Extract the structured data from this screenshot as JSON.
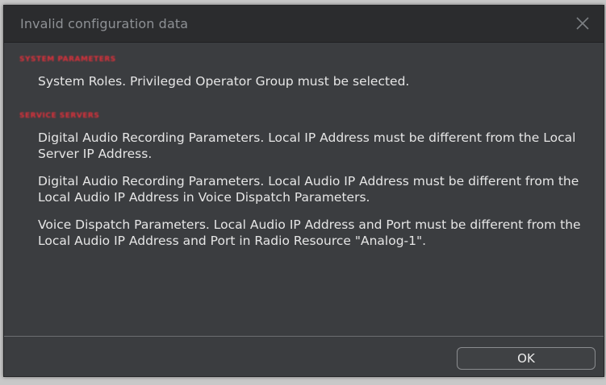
{
  "dialog": {
    "title": "Invalid configuration data",
    "close_icon": "close-icon",
    "ok_label": "OK"
  },
  "sections": [
    {
      "header": "SYSTEM PARAMETERS",
      "header_color": "#e0303a",
      "messages": [
        "System Roles. Privileged Operator Group must be selected."
      ]
    },
    {
      "header": "SERVICE SERVERS",
      "header_color": "#e0303a",
      "messages": [
        "Digital Audio Recording Parameters. Local IP Address must be different from the Local Server IP Address.",
        "Digital Audio Recording Parameters. Local Audio IP Address must be different from the Local Audio IP Address in Voice Dispatch Parameters.",
        "Voice Dispatch Parameters. Local Audio IP Address and Port must be different from the Local Audio IP Address and Port in Radio Resource \"Analog-1\"."
      ]
    }
  ],
  "colors": {
    "dialog_bg": "#3b3d40",
    "titlebar_bg": "#2b2c2e",
    "title_text": "#8e9195",
    "message_text": "#e6e6e6"
  }
}
